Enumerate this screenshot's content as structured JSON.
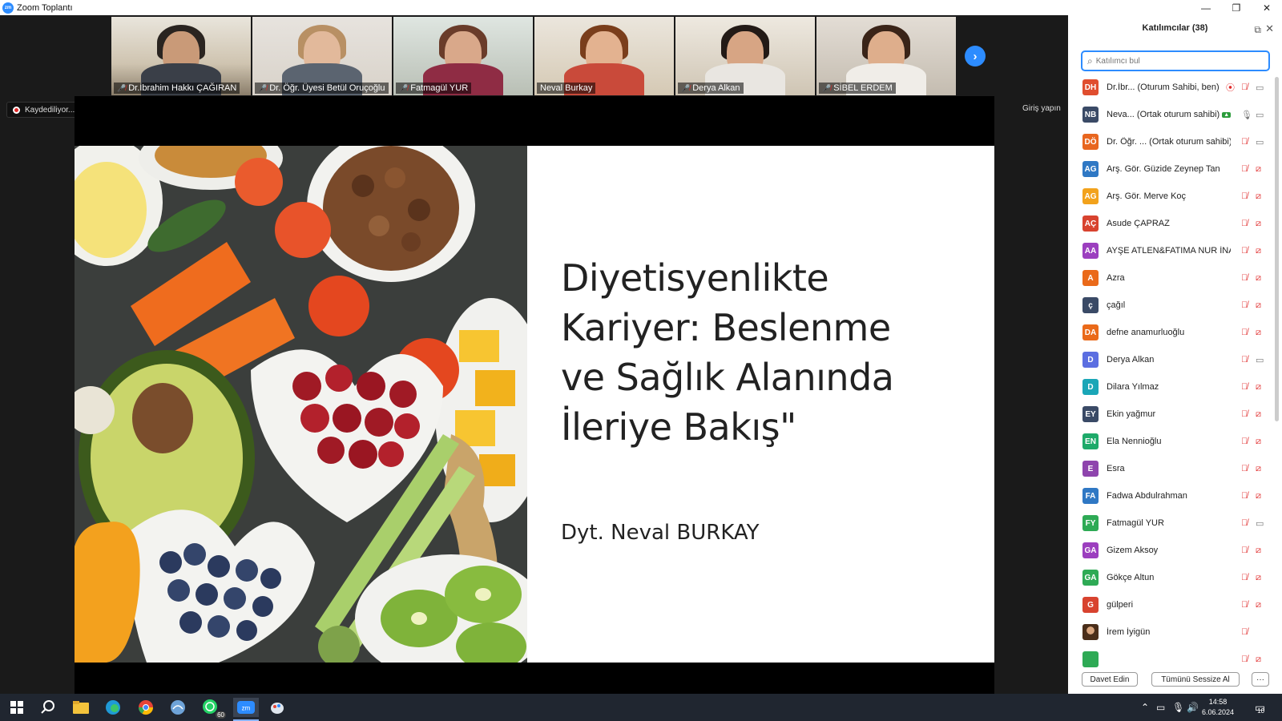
{
  "window": {
    "title": "Zoom Toplantı",
    "minimize": "—",
    "restore": "❐",
    "close": "✕"
  },
  "gallery": {
    "participants": [
      {
        "name": "Dr.İbrahim Hakkı ÇAĞIRAN",
        "muted": true,
        "active": true
      },
      {
        "name": "Dr. Öğr. Üyesi Betül Oruçoğlu",
        "muted": true,
        "active": false
      },
      {
        "name": "Fatmagül YUR",
        "muted": true,
        "active": false
      },
      {
        "name": "Neval Burkay",
        "muted": false,
        "active": false
      },
      {
        "name": "Derya Alkan",
        "muted": true,
        "active": false
      },
      {
        "name": "SİBEL ERDEM",
        "muted": true,
        "active": false
      }
    ],
    "next_icon": "›"
  },
  "recording_label": "Kaydediliyor...",
  "signin_label": "Giriş yapın",
  "slide": {
    "title_lines": [
      "Diyetisyenlikte",
      "Kariyer: Beslenme",
      "ve Sağlık Alanında",
      "İleriye Bakış\""
    ],
    "author": "Dyt. Neval BURKAY"
  },
  "panel": {
    "title": "Katılımcılar (38)",
    "search_placeholder": "Katılımcı bul",
    "participants": [
      {
        "initials": "DH",
        "color": "#e04e2f",
        "name": "Dr.İbr... (Oturum Sahibi, ben)",
        "rec": true,
        "mic": "muted",
        "cam": "on"
      },
      {
        "initials": "NB",
        "color": "#3a4a66",
        "name": "Neva... (Ortak oturum sahibi)",
        "screen_badge": true,
        "mic": "on",
        "cam": "on"
      },
      {
        "initials": "DÖ",
        "color": "#e8661f",
        "name": "Dr. Öğr. ... (Ortak oturum sahibi)",
        "mic": "muted",
        "cam": "on"
      },
      {
        "initials": "AG",
        "color": "#2f78c4",
        "name": "Arş. Gör. Güzide Zeynep Tan",
        "mic": "muted",
        "cam": "off"
      },
      {
        "initials": "AG",
        "color": "#f2a21c",
        "name": "Arş. Gör. Merve Koç",
        "mic": "muted",
        "cam": "off"
      },
      {
        "initials": "AÇ",
        "color": "#d8432f",
        "name": "Asude ÇAPRAZ",
        "mic": "muted",
        "cam": "off"
      },
      {
        "initials": "AA",
        "color": "#9c3fbf",
        "name": "AYŞE ATLEN&FATIMA NUR İNA...",
        "mic": "muted",
        "cam": "off"
      },
      {
        "initials": "A",
        "color": "#ea6a1a",
        "name": "Azra",
        "mic": "muted",
        "cam": "off"
      },
      {
        "initials": "ç",
        "color": "#3a4a66",
        "name": "çağıl",
        "mic": "muted",
        "cam": "off"
      },
      {
        "initials": "DA",
        "color": "#ea6a1a",
        "name": "defne anamurluoğlu",
        "mic": "muted",
        "cam": "off"
      },
      {
        "initials": "D",
        "color": "#5b6ee1",
        "name": "Derya Alkan",
        "mic": "muted",
        "cam": "on"
      },
      {
        "initials": "D",
        "color": "#1aa6b7",
        "name": "Dilara Yılmaz",
        "mic": "muted",
        "cam": "off"
      },
      {
        "initials": "EY",
        "color": "#3a4a66",
        "name": "Ekin yağmur",
        "mic": "muted",
        "cam": "off"
      },
      {
        "initials": "EN",
        "color": "#1eaa6a",
        "name": "Ela Nennioğlu",
        "mic": "muted",
        "cam": "off"
      },
      {
        "initials": "E",
        "color": "#8e44ad",
        "name": "Esra",
        "mic": "muted",
        "cam": "off"
      },
      {
        "initials": "FA",
        "color": "#2f78c4",
        "name": "Fadwa Abdulrahman",
        "mic": "muted",
        "cam": "off"
      },
      {
        "initials": "FY",
        "color": "#2eaa55",
        "name": "Fatmagül YUR",
        "mic": "muted",
        "cam": "on"
      },
      {
        "initials": "GA",
        "color": "#9c3fbf",
        "name": "Gizem Aksoy",
        "mic": "muted",
        "cam": "off"
      },
      {
        "initials": "GA",
        "color": "#2eaa55",
        "name": "Gökçe Altun",
        "mic": "muted",
        "cam": "off"
      },
      {
        "initials": "G",
        "color": "#d8432f",
        "name": "gülperi",
        "mic": "muted",
        "cam": "off"
      },
      {
        "initials": "",
        "color": "#6b4a2a",
        "name": "İrem İyigün",
        "photo": true,
        "mic": "muted"
      },
      {
        "initials": "",
        "color": "#2eaa55",
        "name": "",
        "mic": "muted",
        "cam": "off"
      }
    ],
    "invite_label": "Davet Edin",
    "mute_all_label": "Tümünü Sessize Al",
    "more_label": "···"
  },
  "taskbar": {
    "whatsapp_badge": "60",
    "time": "14:58",
    "date": "6.06.2024",
    "notification_count": "10"
  }
}
